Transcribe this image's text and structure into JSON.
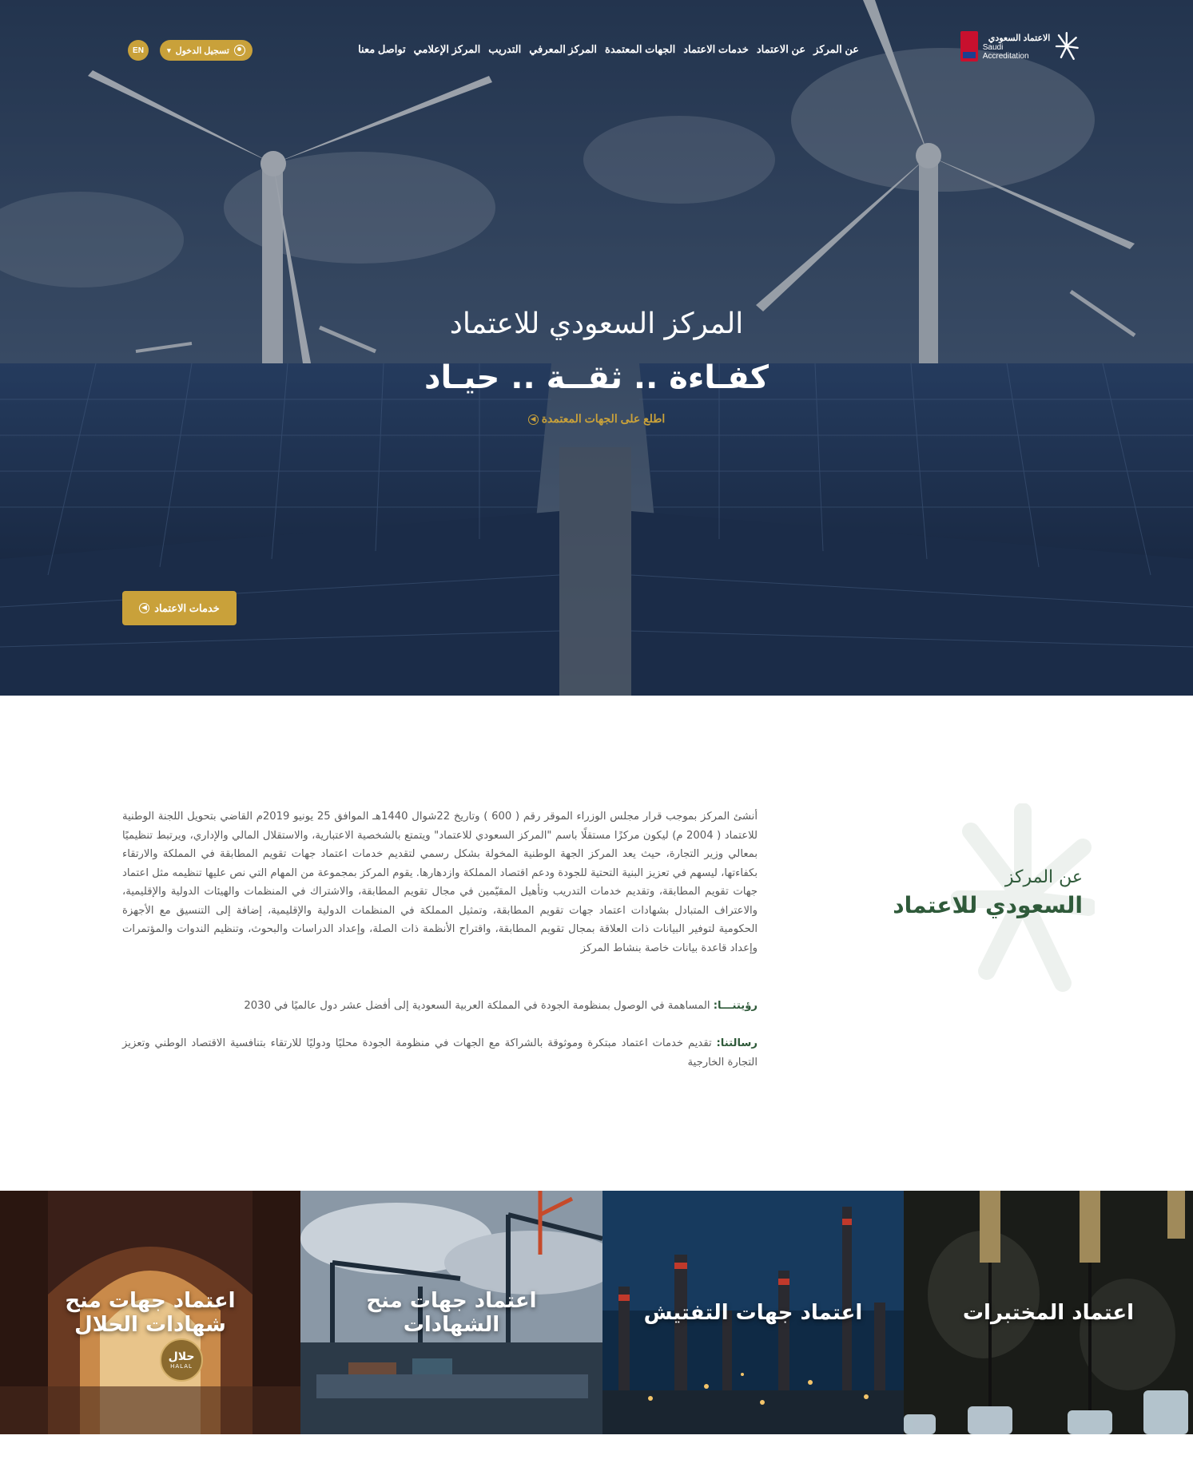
{
  "nav": {
    "logo": {
      "arabic": "الاعتماد السعودي",
      "english": "Saudi Accreditation"
    },
    "items": [
      {
        "label": "عن المركز"
      },
      {
        "label": "عن الاعتماد"
      },
      {
        "label": "خدمات الاعتماد"
      },
      {
        "label": "الجهات المعتمدة"
      },
      {
        "label": "المركز المعرفي"
      },
      {
        "label": "التدريب"
      },
      {
        "label": "المركز الإعلامي"
      },
      {
        "label": "تواصل معنا"
      }
    ],
    "login_label": "تسجيل الدخول",
    "lang_label": "EN"
  },
  "hero": {
    "subtitle": "المركز السعودي للاعتماد",
    "title": "كفـاءة .. ثقــة .. حيـاد",
    "link_label": "اطلع على الجهات المعتمدة",
    "services_button": "خدمات الاعتماد"
  },
  "about": {
    "heading_small": "عن المركز",
    "heading_big": "السعودي للاعتماد",
    "body": "أنشئ المركز بموجب قرار مجلس الوزراء الموقر رقم ( 600 ) وتاريخ 22شوال 1440هـ الموافق 25 يونيو 2019م القاضي بتحويل اللجنة الوطنية للاعتماد ( 2004 م) ليكون مركزًا مستقلًا باسم \"المركز السعودي للاعتماد\" ويتمتع بالشخصية الاعتبارية، والاستقلال المالي والإداري، ويرتبط تنظيميًا بمعالي وزير التجارة، حيث يعد المركز الجهة الوطنية المخولة بشكل رسمي لتقديم خدمات اعتماد جهات تقويم المطابقة في المملكة والارتقاء بكفاءتها، ليسهم في تعزيز البنية التحتية للجودة ودعم اقتصاد المملكة وازدهارها. يقوم المركز بمجموعة من المهام التي نص عليها تنظيمه مثل اعتماد جهات تقويم المطابقة، وتقديم خدمات التدريب وتأهيل المقيّمين في مجال تقويم المطابقة، والاشتراك في المنظمات والهيئات الدولية والإقليمية، والاعتراف المتبادل بشهادات اعتماد جهات تقويم المطابقة، وتمثيل المملكة في المنظمات الدولية والإقليمية، إضافة إلى التنسيق مع الأجهزة الحكومية لتوفير البيانات ذات العلاقة بمجال تقويم المطابقة، واقتراح الأنظمة ذات الصلة، وإعداد الدراسات والبحوث، وتنظيم الندوات والمؤتمرات وإعداد قاعدة بيانات خاصة بنشاط المركز",
    "vision_label": "رؤيتنـــا:",
    "vision_text": " المساهمة في الوصول بمنظومة الجودة في المملكة العربية السعودية إلى أفضل عشر دول عالميًا في 2030",
    "mission_label": "رسالتنا:",
    "mission_text": " تقديم خدمات اعتماد مبتكرة وموثوقة بالشراكة مع الجهات في منظومة الجودة محليًا ودوليًا للارتقاء بتنافسية الاقتصاد الوطني وتعزيز التجارة الخارجية"
  },
  "cards": [
    {
      "title": "اعتماد جهات منح شهادات الحلال",
      "badge_ar": "حلال",
      "badge_en": "HALAL"
    },
    {
      "title": "اعتماد جهات منح الشهادات"
    },
    {
      "title": "اعتماد جهات التفتيش"
    },
    {
      "title": "اعتماد المختبرات"
    }
  ],
  "colors": {
    "gold": "#c9a13a",
    "green": "#2f5a3a",
    "text_gray": "#5a5a5a"
  }
}
